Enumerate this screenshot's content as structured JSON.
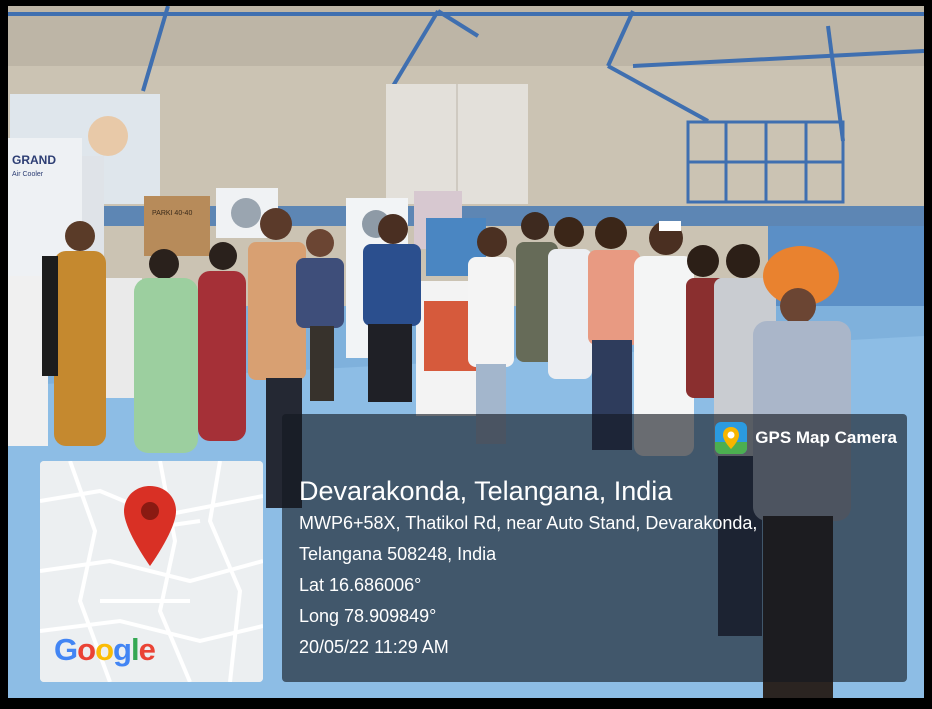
{
  "gps_overlay": {
    "app_name": "GPS Map Camera",
    "app_icon": "gps-map-camera-icon",
    "location_title": "Devarakonda, Telangana, India",
    "address_line_1": "MWP6+58X, Thatikol Rd, near Auto Stand, Devarakonda,",
    "address_line_2": "Telangana 508248, India",
    "latitude": "Lat 16.686006°",
    "longitude": "Long 78.909849°",
    "datetime": "20/05/22 11:29 AM"
  },
  "map_thumbnail": {
    "logo_letters": [
      "G",
      "o",
      "o",
      "g",
      "l",
      "e"
    ],
    "logo_colors": [
      "#4285F4",
      "#EA4335",
      "#FBBC05",
      "#4285F4",
      "#34A853",
      "#EA4335"
    ],
    "pin_icon": "map-pin-icon",
    "pin_color": "#d93025"
  },
  "photo_text": {
    "cooler_box_brand": "GRAND",
    "cooler_box_sub": "Air Cooler",
    "carton_label": "PARKI 40-40"
  }
}
